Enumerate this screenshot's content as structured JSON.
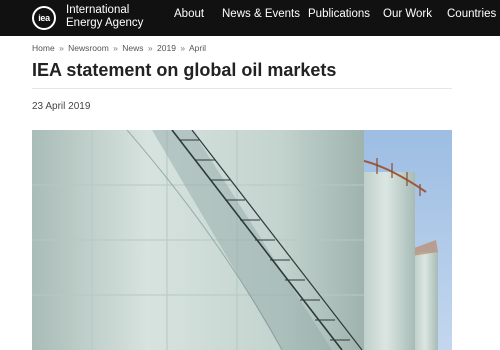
{
  "header": {
    "brand_line1": "International",
    "brand_line2": "Energy Agency",
    "logo_text": "iea",
    "nav": [
      "About",
      "News & Events",
      "Publications",
      "Our Work",
      "Countries"
    ]
  },
  "breadcrumb": [
    "Home",
    "Newsroom",
    "News",
    "2019",
    "April"
  ],
  "breadcrumb_separator": "»",
  "article": {
    "title": "IEA statement on global oil markets",
    "date": "23 April 2019"
  },
  "hero": {
    "icon": "oil-storage-tanks-photo",
    "colors": {
      "sky": "#a9c6e6",
      "tank": "#cfdcd7",
      "shadow": "#8fa6a3"
    }
  }
}
